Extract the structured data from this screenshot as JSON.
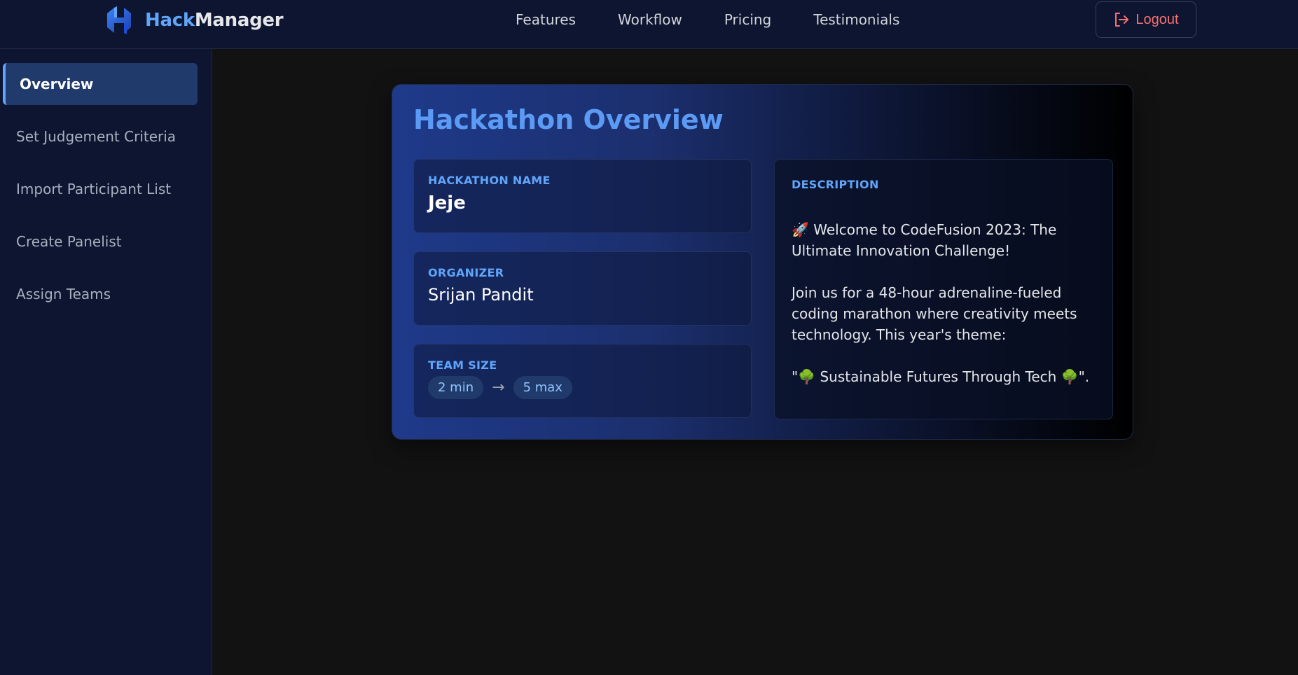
{
  "header": {
    "brand_hack": "Hack",
    "brand_manager": "Manager",
    "nav": [
      "Features",
      "Workflow",
      "Pricing",
      "Testimonials"
    ],
    "logout_label": "Logout",
    "logout_color": "#f87171"
  },
  "sidebar": {
    "items": [
      {
        "label": "Overview",
        "active": true
      },
      {
        "label": "Set Judgement Criteria",
        "active": false
      },
      {
        "label": "Import Participant List",
        "active": false
      },
      {
        "label": "Create Panelist",
        "active": false
      },
      {
        "label": "Assign Teams",
        "active": false
      }
    ]
  },
  "overview": {
    "title": "Hackathon Overview",
    "name_label": "HACKATHON NAME",
    "name_value": "Jeje",
    "organizer_label": "ORGANIZER",
    "organizer_value": "Srijan Pandit",
    "team_size_label": "TEAM SIZE",
    "team_min": "2 min",
    "team_arrow": "→",
    "team_max": "5 max",
    "description_label": "DESCRIPTION",
    "description_p1": "🚀 Welcome to CodeFusion 2023: The Ultimate Innovation Challenge!",
    "description_p2": "Join us for a 48-hour adrenaline-fueled coding marathon where creativity meets technology. This year's theme:",
    "description_p3": "\"🌳 Sustainable Futures Through Tech 🌳\".",
    "accent_color": "#60a5fa"
  }
}
